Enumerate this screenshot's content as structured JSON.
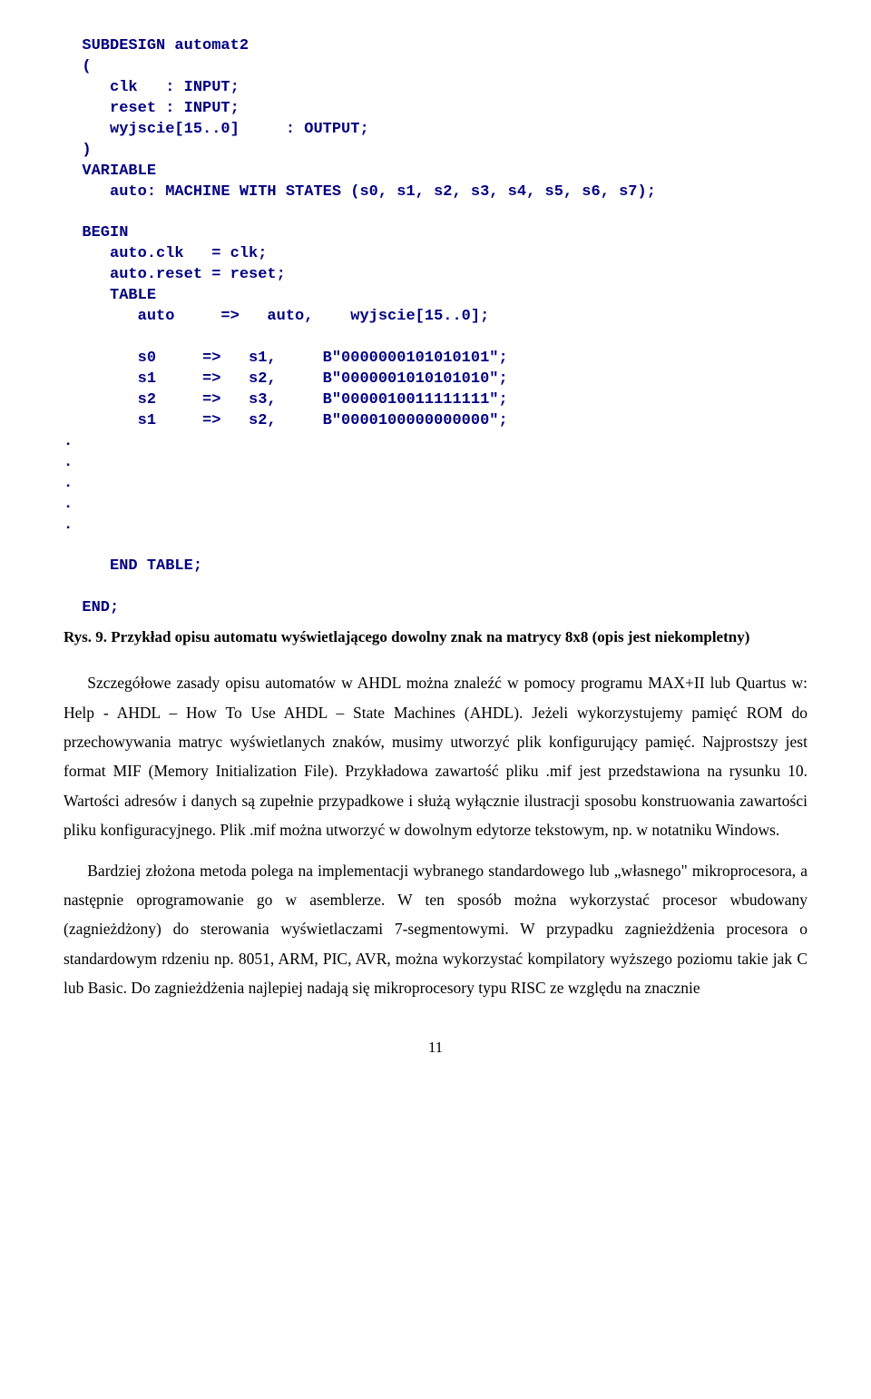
{
  "code": "  SUBDESIGN automat2\n  (\n     clk   : INPUT;\n     reset : INPUT;\n     wyjscie[15..0]     : OUTPUT;\n  )\n  VARIABLE\n     auto: MACHINE WITH STATES (s0, s1, s2, s3, s4, s5, s6, s7);\n\n  BEGIN\n     auto.clk   = clk;\n     auto.reset = reset;\n     TABLE\n        auto     =>   auto,    wyjscie[15..0];\n\n        s0     =>   s1,     B\"0000000101010101\";\n        s1     =>   s2,     B\"0000001010101010\";\n        s2     =>   s3,     B\"0000010011111111\";\n        s1     =>   s2,     B\"0000100000000000\";\n.\n.\n.\n.\n.\n\n     END TABLE;\n\n  END;",
  "caption": "Rys. 9. Przykład opisu automatu wyświetlającego dowolny znak na matrycy 8x8 (opis jest niekompletny)",
  "para1": "Szczegółowe zasady opisu automatów w AHDL można znaleźć w pomocy programu MAX+II lub Quartus w: Help - AHDL – How To Use AHDL – State Machines (AHDL). Jeżeli wykorzystujemy pamięć ROM do przechowywania matryc wyświetlanych znaków, musimy utworzyć plik konfigurujący pamięć. Najprostszy jest format MIF (Memory Initialization File). Przykładowa zawartość pliku .mif jest przedstawiona na rysunku 10. Wartości adresów i danych są zupełnie przypadkowe i służą wyłącznie ilustracji sposobu konstruowania zawartości pliku konfiguracyjnego. Plik .mif można utworzyć w dowolnym edytorze tekstowym, np. w notatniku Windows.",
  "para2": "Bardziej złożona metoda polega na implementacji wybranego standardowego lub „własnego\" mikroprocesora, a następnie oprogramowanie go w asemblerze. W ten sposób można wykorzystać procesor wbudowany (zagnieżdżony) do sterowania wyświetlaczami 7-segmentowymi. W przypadku zagnieżdżenia procesora o standardowym rdzeniu np. 8051, ARM, PIC, AVR, można wykorzystać kompilatory wyższego poziomu takie jak C lub Basic. Do zagnieżdżenia najlepiej nadają się mikroprocesory typu RISC ze względu na znacznie",
  "pageNumber": "11"
}
